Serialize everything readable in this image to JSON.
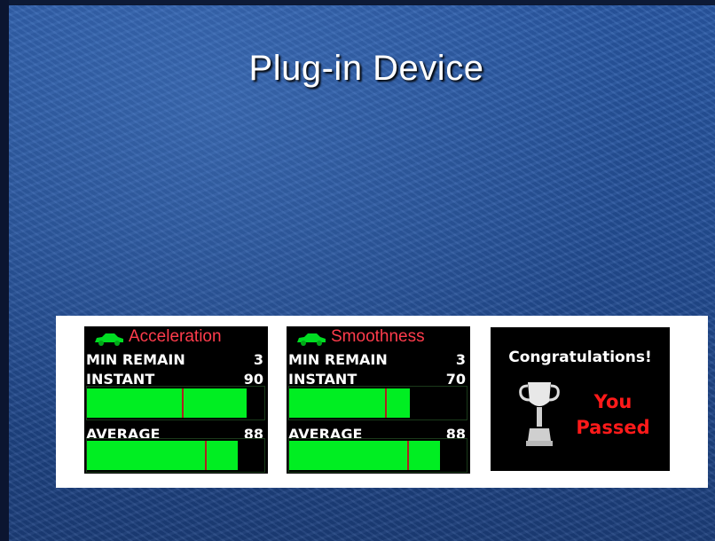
{
  "slide": {
    "title": "Plug-in Device"
  },
  "panels": [
    {
      "heading": "Acceleration",
      "icon": "car-icon",
      "min_remain_label": "MIN REMAIN",
      "min_remain_value": "3",
      "instant_label": "INSTANT",
      "instant_value": "90",
      "average_label": "AVERAGE",
      "average_value": "88"
    },
    {
      "heading": "Smoothness",
      "icon": "car-icon",
      "min_remain_label": "MIN REMAIN",
      "min_remain_value": "3",
      "instant_label": "INSTANT",
      "instant_value": "70",
      "average_label": "AVERAGE",
      "average_value": "88"
    }
  ],
  "result": {
    "heading": "Congratulations!",
    "icon": "trophy-icon",
    "line1": "You",
    "line2": "Passed"
  },
  "colors": {
    "heading_red": "#ff3c4c",
    "bar_green": "#00ee22",
    "passed_red": "#ff1a1a"
  }
}
